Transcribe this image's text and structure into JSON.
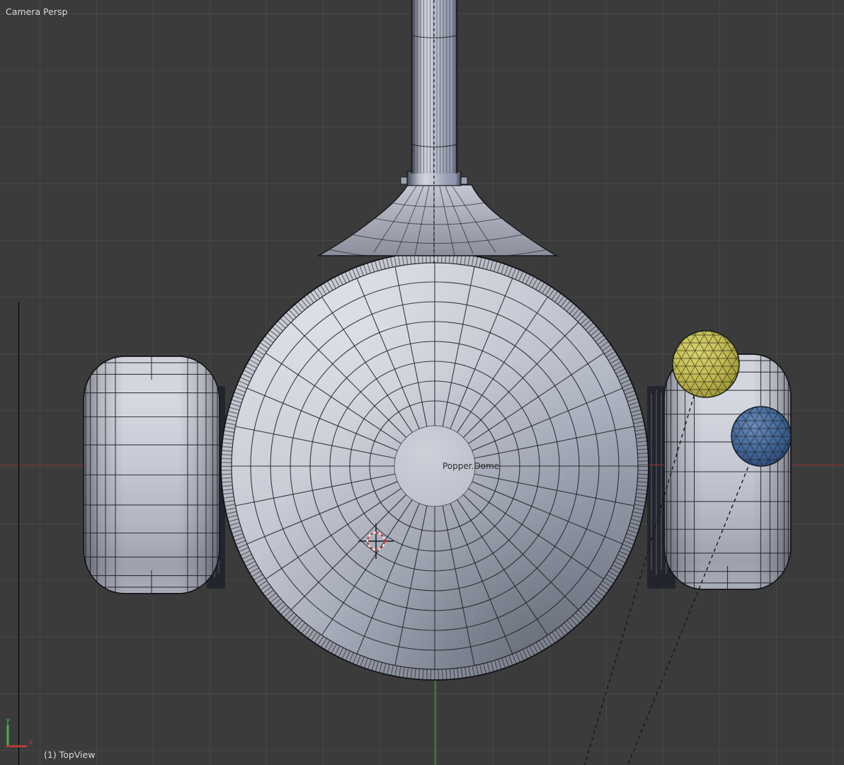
{
  "viewport": {
    "view_label": "Camera Persp",
    "footer_label": "(1) TopView",
    "object_label": "Popper.Dome"
  },
  "mini_axis": {
    "x_label": "x",
    "y_label": "y"
  },
  "colors": {
    "background": "#3b3b3b",
    "grid": "#474747",
    "axis_x": "#8d3232",
    "axis_y": "#3f9b3f",
    "camera_border": "#0a0a0a",
    "wire": "#1d1e24",
    "dashed_relation": "#17171c",
    "text_light": "#d8d8d8",
    "text_dark": "#2c2c2c",
    "cursor_red": "#b8383d",
    "cursor_white": "#ececec",
    "sphere_yellow": "#c3bd55",
    "sphere_blue": "#41638f",
    "mini_axis_x": "#b23c3c",
    "mini_axis_y": "#4cae4c"
  }
}
